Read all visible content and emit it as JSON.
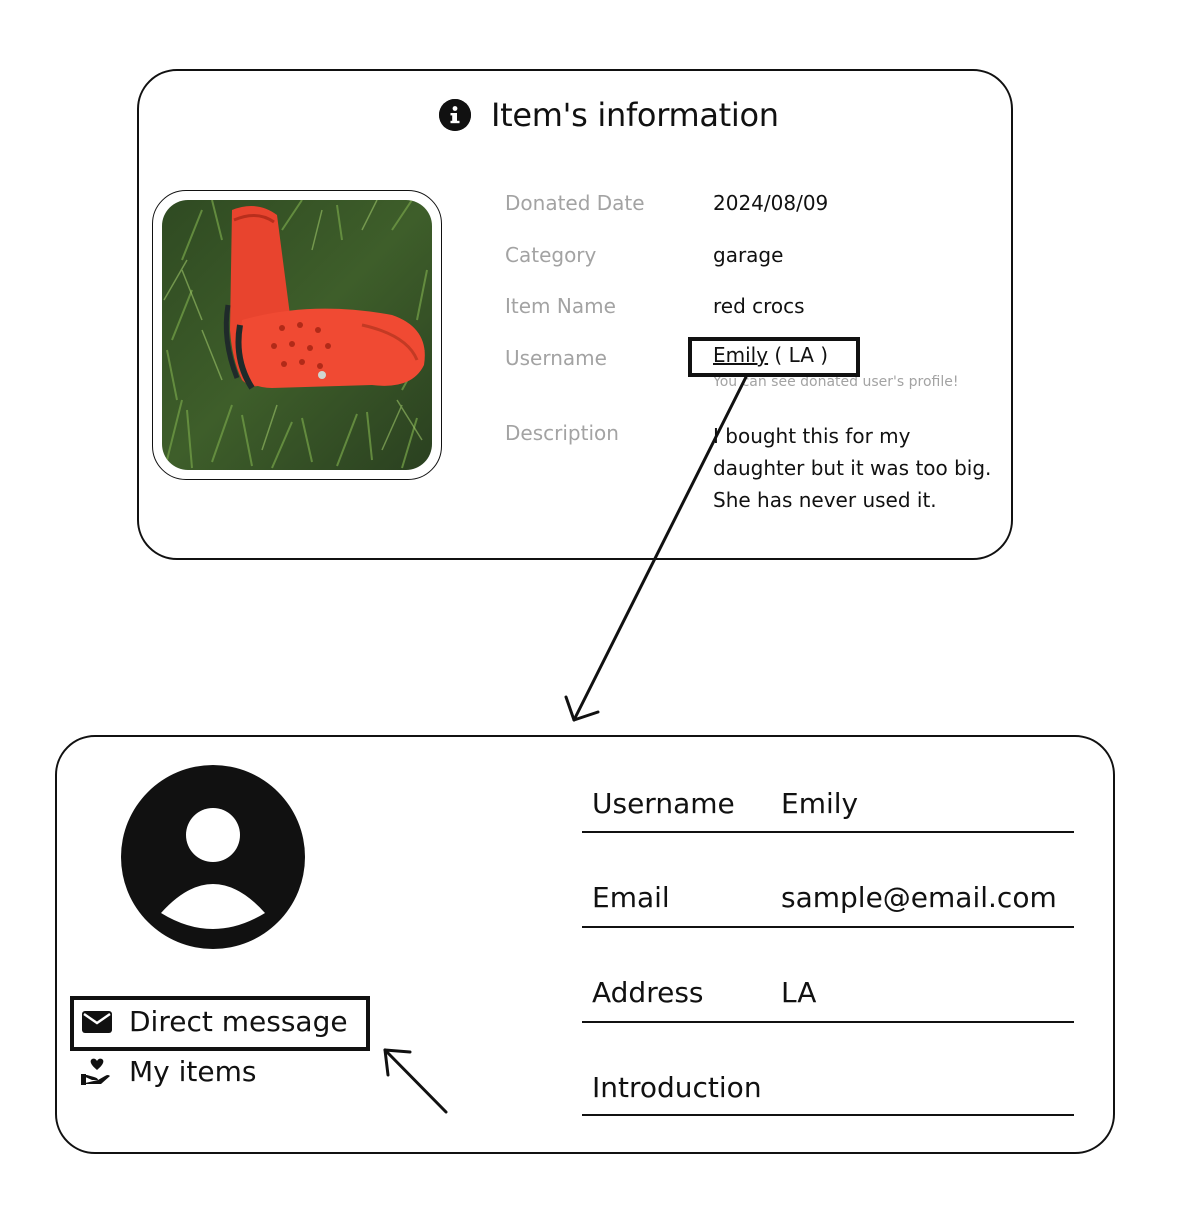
{
  "item_card": {
    "title": "Item's information",
    "icon": "info-circle-icon",
    "photo_alt": "red crocs on grass",
    "fields": {
      "donated_date_label": "Donated Date",
      "donated_date_value": "2024/08/09",
      "category_label": "Category",
      "category_value": "garage",
      "item_name_label": "Item Name",
      "item_name_value": "red crocs",
      "username_label": "Username",
      "username_link": "Emily",
      "username_location": " ( LA )",
      "username_hint": "You can see donated user's profile!",
      "description_label": "Description",
      "description_value": "I bought this for my daughter but it was too big. She has never used it."
    }
  },
  "profile_card": {
    "avatar_icon": "user-circle-icon",
    "direct_message_label": "Direct message",
    "direct_message_icon": "envelope-icon",
    "my_items_label": "My items",
    "my_items_icon": "hand-heart-icon",
    "rows": {
      "username_label": "Username",
      "username_value": "Emily",
      "email_label": "Email",
      "email_value": "sample@email.com",
      "address_label": "Address",
      "address_value": "LA",
      "introduction_label": "Introduction",
      "introduction_value": ""
    }
  },
  "colors": {
    "text": "#111111",
    "muted_label": "#a3a3a3",
    "border": "#111111",
    "background": "#ffffff"
  }
}
